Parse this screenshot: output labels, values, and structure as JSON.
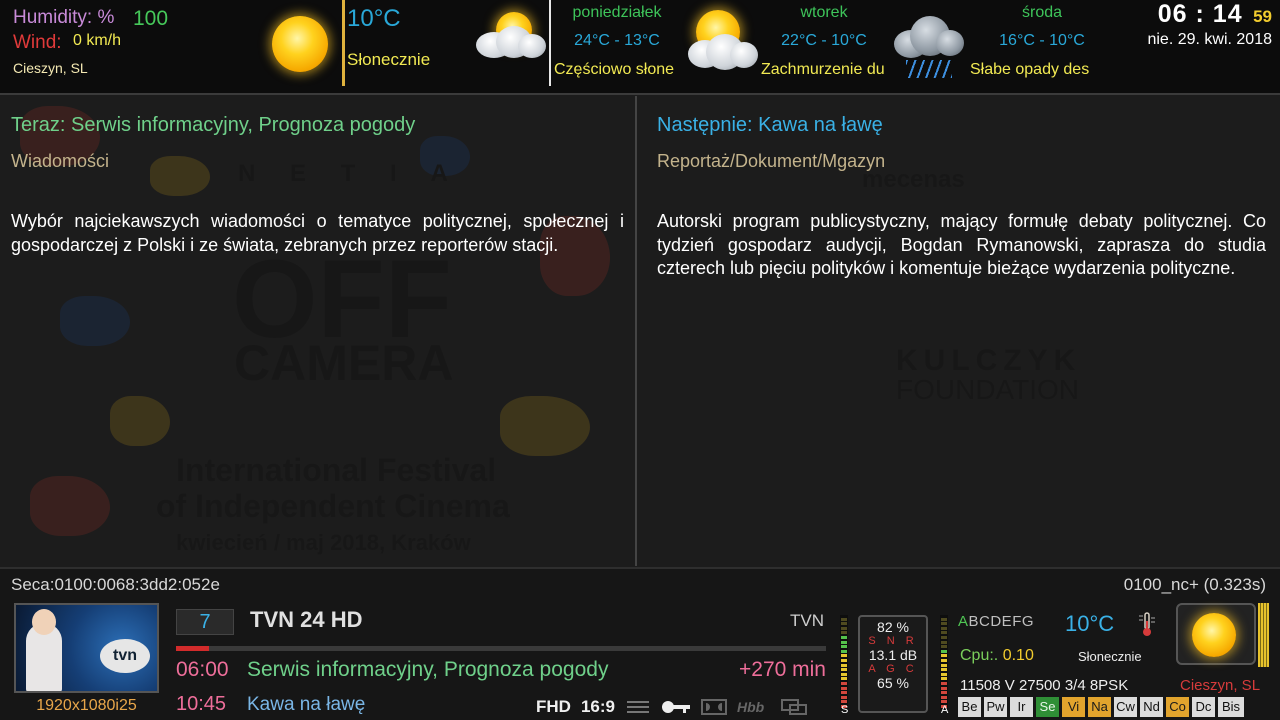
{
  "weather_bar": {
    "humidity_label": "Humidity: %",
    "humidity_value": "100",
    "wind_label": "Wind:",
    "wind_value": "0 km/h",
    "location": "Cieszyn, SL",
    "current_temp": "10°C",
    "current_condition": "Słonecznie",
    "forecast": [
      {
        "day": "poniedziałek",
        "temp": "24°C - 13°C",
        "condition": "Częściowo słone",
        "icon": "partly-cloudy-icon"
      },
      {
        "day": "wtorek",
        "temp": "22°C - 10°C",
        "condition": "Zachmurzenie du",
        "icon": "cloudy-icon"
      },
      {
        "day": "środa",
        "temp": "16°C - 10°C",
        "condition": "Słabe opady des",
        "icon": "rain-icon"
      }
    ]
  },
  "clock": {
    "time": "06 : 14",
    "seconds": "59",
    "date": "nie.  29. kwi. 2018"
  },
  "epg": {
    "now": {
      "title": "Teraz: Serwis informacyjny, Prognoza pogody",
      "genre": "Wiadomości",
      "description": "Wybór najciekawszych wiadomości o tematyce politycznej, społecznej i gospodarczej z Polski i ze świata, zebranych przez reporterów stacji."
    },
    "next": {
      "title": "Następnie: Kawa na ławę",
      "genre": "Reportaż/Dokument/Mgazyn",
      "description": "Autorski program publicystyczny, mający formułę debaty politycznej. Co tydzień gospodarz audycji, Bogdan Rymanowski, zaprasza do studia czterech lub pięciu polityków i komentuje bieżące wydarzenia polityczne."
    }
  },
  "background_poster": {
    "lines": [
      "N E T I A",
      "OFF",
      "CAMERA",
      "International Festival",
      "of Independent Cinema",
      "kwiecień / maj 2018, Kraków",
      "mecenas",
      "KULCZYK",
      "FOUNDATION"
    ]
  },
  "infobar": {
    "caid": "Seca:0100:0068:3dd2:052e",
    "ecm": "0100_nc+ (0.323s)",
    "resolution": "1920x1080i25",
    "channel_number": "7",
    "channel_name": "TVN 24 HD",
    "provider": "TVN",
    "progress_fraction": 0.05,
    "now_time": "06:00",
    "now_title": "Serwis informacyjny, Prognoza pogody",
    "now_remaining": "+270 min",
    "next_time": "10:45",
    "next_title": "Kawa na ławę",
    "flags": {
      "hd": "FHD",
      "aspect": "16:9"
    },
    "flag_icons": [
      "teletext-icon",
      "key-icon",
      "dolby-icon",
      "hbbtv-icon",
      "multiscreen-icon"
    ],
    "snr": {
      "top": "82 %",
      "snr_label": "S N R",
      "db": "13.1 dB",
      "agc_label": "A G C",
      "bottom": "65 %"
    },
    "meter_labels": {
      "left": "S",
      "right": "A"
    },
    "signal_level_fraction": 0.82,
    "agc_level_fraction": 0.65,
    "abc_highlight": "A",
    "abc_rest": "BCDEFG",
    "temp": "10°C",
    "cpu_label": "Cpu:.",
    "cpu_value": "0.10",
    "condition": "Słonecznie",
    "transponder": "11508  V  27500  3/4  8PSK",
    "city": "Cieszyn, SL",
    "ca_systems": [
      {
        "label": "Be",
        "state": "off"
      },
      {
        "label": "Pw",
        "state": "off"
      },
      {
        "label": "Ir",
        "state": "off"
      },
      {
        "label": "Se",
        "state": "on"
      },
      {
        "label": "Vi",
        "state": "sel"
      },
      {
        "label": "Na",
        "state": "sel"
      },
      {
        "label": "Cw",
        "state": "off"
      },
      {
        "label": "Nd",
        "state": "off"
      },
      {
        "label": "Co",
        "state": "sel"
      },
      {
        "label": "Dc",
        "state": "off"
      },
      {
        "label": "Bis",
        "state": "off"
      }
    ]
  },
  "colors": {
    "green": "#3ec45a",
    "blue": "#29a8d8",
    "yellow": "#f2ea53",
    "pink": "#ee6e9a",
    "red": "#d63b3b"
  }
}
